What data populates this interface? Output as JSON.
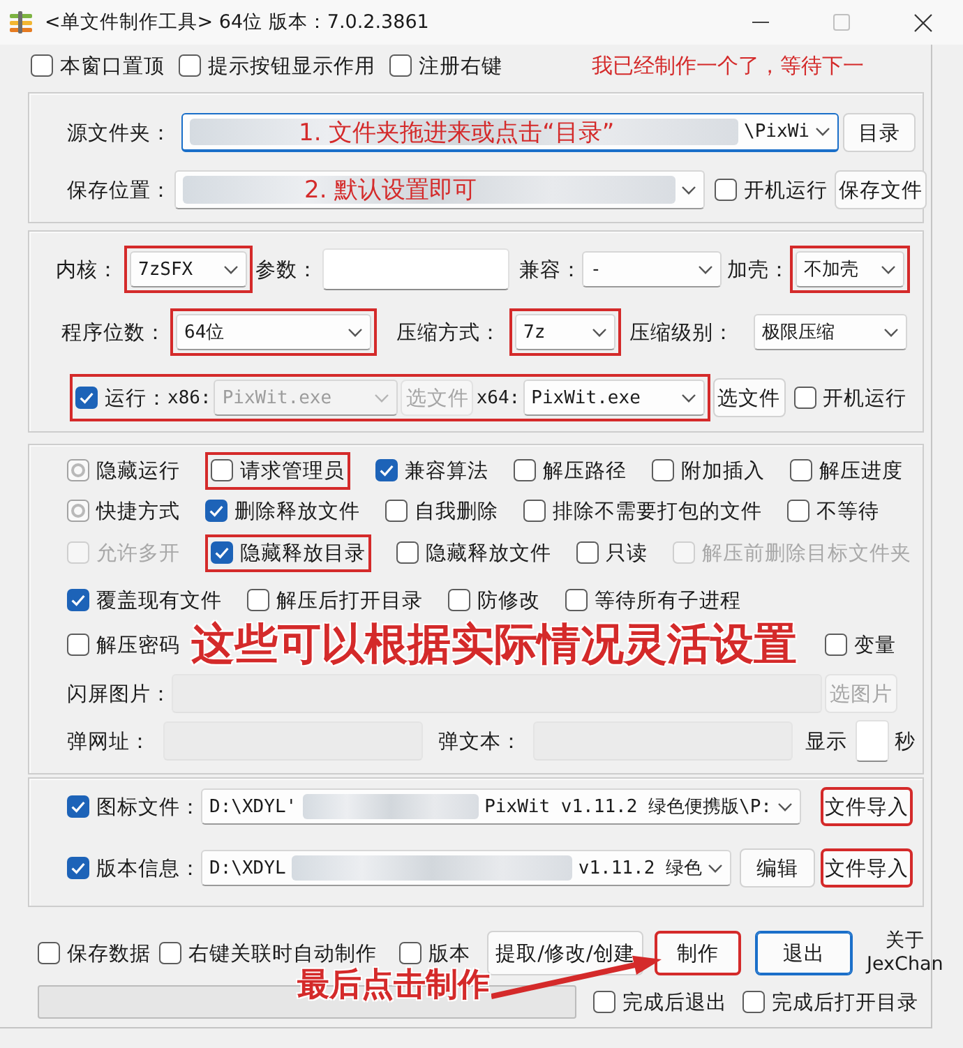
{
  "window": {
    "title": "<单文件制作工具> 64位 版本：7.0.2.3861"
  },
  "top_options": [
    {
      "label": "本窗口置顶",
      "checked": false
    },
    {
      "label": "提示按钮显示作用",
      "checked": false
    },
    {
      "label": "注册右键",
      "checked": false
    }
  ],
  "top_note": "我已经制作一个了，等待下一",
  "source_folder": {
    "label": "源文件夹：",
    "value_end": "\\PixWi",
    "redacted": true,
    "focused": true,
    "note": "1. 文件夹拖进来或点击“目录”",
    "button": "目录"
  },
  "save_location": {
    "label": "保存位置：",
    "redacted": true,
    "focused": false,
    "note": "2. 默认设置即可",
    "startup": {
      "label": "开机运行",
      "checked": false
    },
    "button": "保存文件"
  },
  "settings": {
    "kernel": {
      "label": "内核：",
      "value": "7zSFX",
      "highlighted": true
    },
    "params": {
      "label": "参数：",
      "disabled": false
    },
    "compat": {
      "label": "兼容：",
      "value": "-",
      "highlighted": false
    },
    "shell": {
      "label": "加壳：",
      "value": "不加壳",
      "highlighted": true
    },
    "bits": {
      "label": "程序位数：",
      "value": "64位",
      "highlighted": true
    },
    "method": {
      "label": "压缩方式：",
      "value": "7z",
      "highlighted": true
    },
    "compression_level": {
      "label": "压缩级别：",
      "value": "极限压缩",
      "highlighted": false
    }
  },
  "run": {
    "label": "运行：",
    "checked": true,
    "highlighted": true,
    "x86_label": "x86:",
    "x86": {
      "value": "PixWit.exe",
      "disabled": true
    },
    "x86_button": {
      "label": "选文件",
      "disabled": true
    },
    "x64_label": "x64:",
    "x64": {
      "value": "PixWit.exe",
      "disabled": false
    },
    "x64_button": {
      "label": "选文件",
      "disabled": false
    },
    "startup": {
      "label": "开机运行",
      "checked": false
    }
  },
  "option_rows": [
    {
      "items": [
        {
          "label": "隐藏运行",
          "checked": false,
          "indeterminate": true,
          "disabled": false,
          "highlighted": false
        },
        {
          "label": "请求管理员",
          "checked": false,
          "indeterminate": false,
          "disabled": false,
          "highlighted": true
        },
        {
          "label": "兼容算法",
          "checked": true,
          "indeterminate": false,
          "disabled": false,
          "highlighted": false
        },
        {
          "label": "解压路径",
          "checked": false,
          "indeterminate": false,
          "disabled": false,
          "highlighted": false
        },
        {
          "label": "附加插入",
          "checked": false,
          "indeterminate": false,
          "disabled": false,
          "highlighted": false
        },
        {
          "label": "解压进度",
          "checked": false,
          "indeterminate": false,
          "disabled": false,
          "highlighted": false
        }
      ]
    },
    {
      "items": [
        {
          "label": "快捷方式",
          "checked": false,
          "indeterminate": true,
          "disabled": false,
          "highlighted": false
        },
        {
          "label": "删除释放文件",
          "checked": true,
          "indeterminate": false,
          "disabled": false,
          "highlighted": false
        },
        {
          "label": "自我删除",
          "checked": false,
          "indeterminate": false,
          "disabled": false,
          "highlighted": false
        },
        {
          "label": "排除不需要打包的文件",
          "checked": false,
          "indeterminate": false,
          "disabled": false,
          "highlighted": false
        },
        {
          "label": "不等待",
          "checked": false,
          "indeterminate": false,
          "disabled": false,
          "highlighted": false
        }
      ]
    },
    {
      "items": [
        {
          "label": "允许多开",
          "checked": false,
          "indeterminate": false,
          "disabled": true,
          "highlighted": false
        },
        {
          "label": "隐藏释放目录",
          "checked": true,
          "indeterminate": false,
          "disabled": false,
          "highlighted": true
        },
        {
          "label": "隐藏释放文件",
          "checked": false,
          "indeterminate": false,
          "disabled": false,
          "highlighted": false
        },
        {
          "label": "只读",
          "checked": false,
          "indeterminate": false,
          "disabled": false,
          "highlighted": false
        },
        {
          "label": "解压前删除目标文件夹",
          "checked": false,
          "indeterminate": false,
          "disabled": true,
          "highlighted": false
        }
      ]
    },
    {
      "items": [
        {
          "label": "覆盖现有文件",
          "checked": true,
          "indeterminate": false,
          "disabled": false,
          "highlighted": false
        },
        {
          "label": "解压后打开目录",
          "checked": false,
          "indeterminate": false,
          "disabled": false,
          "highlighted": false
        },
        {
          "label": "防修改",
          "checked": false,
          "indeterminate": false,
          "disabled": false,
          "highlighted": false
        },
        {
          "label": "等待所有子进程",
          "checked": false,
          "indeterminate": false,
          "disabled": false,
          "highlighted": false
        }
      ]
    },
    {
      "items": [
        {
          "label": "解压密码",
          "checked": false,
          "indeterminate": false,
          "disabled": false,
          "highlighted": false
        },
        {
          "label": "变量",
          "checked": false,
          "indeterminate": false,
          "disabled": false,
          "highlighted": false
        }
      ],
      "note": "这些可以根据实际情况灵活设置"
    }
  ],
  "splash": {
    "label": "闪屏图片：",
    "disabled": true,
    "button": {
      "label": "选图片",
      "disabled": true
    }
  },
  "popup": {
    "url": {
      "label": "弹网址：",
      "disabled": true
    },
    "text": {
      "label": "弹文本：",
      "disabled": true
    },
    "show": {
      "label": "显示",
      "unit": "秒",
      "disabled": false
    }
  },
  "icon_file": {
    "label": "图标文件：",
    "checked": true,
    "value_start": "D:\\XDYL'",
    "value_end": "PixWit v1.11.2 绿色便携版\\P:",
    "redacted": true,
    "button": {
      "label": "文件导入",
      "highlighted": true
    }
  },
  "version_info": {
    "label": "版本信息：",
    "checked": true,
    "value_start": "D:\\XDYL",
    "value_end": "v1.11.2 绿色",
    "redacted": true,
    "edit_button": {
      "label": "编辑",
      "highlighted": false
    },
    "button": {
      "label": "文件导入",
      "highlighted": true
    }
  },
  "bottom_options": [
    {
      "label": "保存数据",
      "checked": false
    },
    {
      "label": "右键关联时自动制作",
      "checked": false
    },
    {
      "label": "版本",
      "checked": false
    }
  ],
  "actions": [
    {
      "label": "提取/修改/创建",
      "default": false,
      "highlighted": false
    },
    {
      "label": "制作",
      "default": false,
      "highlighted": true
    },
    {
      "label": "退出",
      "default": true,
      "highlighted": false
    }
  ],
  "about": [
    "关于",
    "JexChan"
  ],
  "progress": {
    "level": 0
  },
  "after_options": [
    {
      "label": "完成后退出",
      "checked": false
    },
    {
      "label": "完成后打开目录",
      "checked": false
    }
  ],
  "final_note": "最后点击制作"
}
